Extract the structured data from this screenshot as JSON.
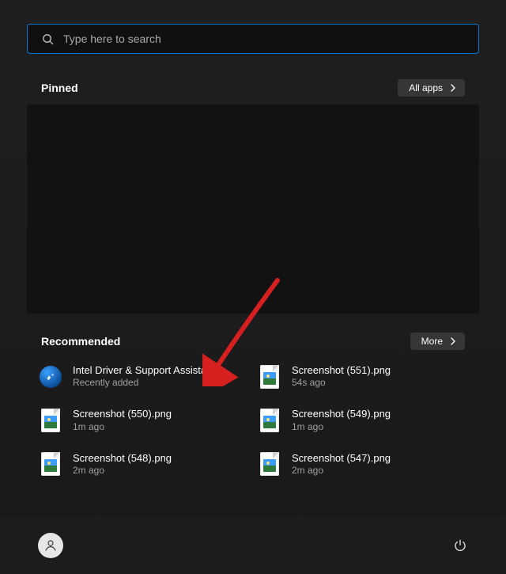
{
  "search": {
    "placeholder": "Type here to search"
  },
  "pinned": {
    "title": "Pinned",
    "all_apps_label": "All apps"
  },
  "recommended": {
    "title": "Recommended",
    "more_label": "More",
    "items": [
      {
        "title": "Intel Driver & Support Assistant",
        "subtitle": "Recently added",
        "icon": "intel"
      },
      {
        "title": "Screenshot (551).png",
        "subtitle": "54s ago",
        "icon": "image"
      },
      {
        "title": "Screenshot (550).png",
        "subtitle": "1m ago",
        "icon": "image"
      },
      {
        "title": "Screenshot (549).png",
        "subtitle": "1m ago",
        "icon": "image"
      },
      {
        "title": "Screenshot (548).png",
        "subtitle": "2m ago",
        "icon": "image"
      },
      {
        "title": "Screenshot (547).png",
        "subtitle": "2m ago",
        "icon": "image"
      }
    ]
  }
}
